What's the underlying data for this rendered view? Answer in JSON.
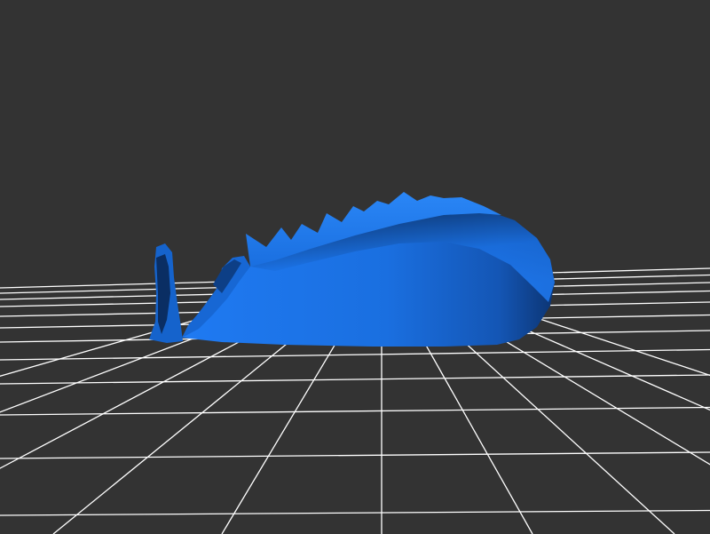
{
  "scene": {
    "background_color": "#333333",
    "grid_color": "#ffffff",
    "model_color": "#1a6fe0",
    "model_shadow_color": "#0a2e63",
    "model_highlight_color": "#2a8cff"
  }
}
